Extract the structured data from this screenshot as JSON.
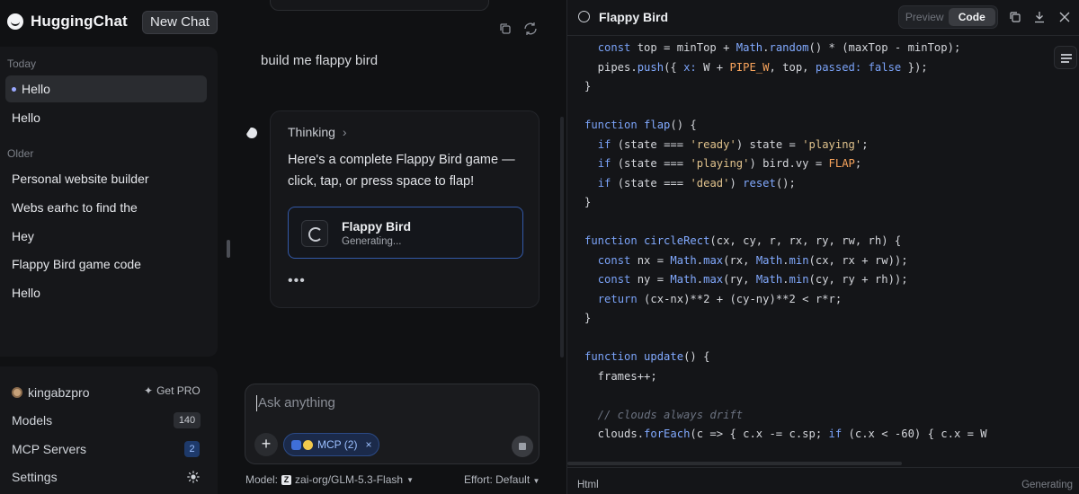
{
  "app": {
    "name": "HuggingChat",
    "new_chat": "New Chat"
  },
  "sidebar": {
    "today_label": "Today",
    "older_label": "Older",
    "today_items": [
      "Hello",
      "Hello"
    ],
    "older_items": [
      "Personal website builder",
      "Webs earhc to find the",
      "Hey",
      "Flappy Bird game code",
      "Hello"
    ],
    "user": "kingabzpro",
    "get_pro": "Get PRO",
    "models_label": "Models",
    "models_count": "140",
    "mcp_label": "MCP Servers",
    "mcp_count": "2",
    "settings_label": "Settings"
  },
  "chat": {
    "user_message": "build me flappy bird",
    "thinking": "Thinking",
    "assistant_text": "Here's a complete Flappy Bird game — click, tap, or press space to flap!",
    "artifact_title": "Flappy Bird",
    "artifact_status": "Generating...",
    "dots": "•••",
    "input_placeholder": "Ask anything",
    "mcp_chip": "MCP (2)",
    "model_label": "Model:",
    "model_name": "zai-org/GLM-5.3-Flash",
    "effort": "Effort: Default"
  },
  "code_panel": {
    "title": "Flappy Bird",
    "tabs": [
      "Preview",
      "Code"
    ],
    "active_tab": "Code",
    "language": "Html",
    "status": "Generating",
    "lines": [
      [
        [
          "",
          "  "
        ],
        [
          "k",
          "const"
        ],
        [
          "",
          " top = minTop + "
        ],
        [
          "f",
          "Math"
        ],
        [
          "",
          "."
        ],
        [
          "f",
          "random"
        ],
        [
          "",
          "() * (maxTop - minTop);"
        ]
      ],
      [
        [
          "",
          "  pipes."
        ],
        [
          "f",
          "push"
        ],
        [
          "",
          "({ "
        ],
        [
          "k",
          "x:"
        ],
        [
          "",
          " W + "
        ],
        [
          "n",
          "PIPE_W"
        ],
        [
          "",
          ", top, "
        ],
        [
          "k",
          "passed:"
        ],
        [
          "",
          " "
        ],
        [
          "k",
          "false"
        ],
        [
          "",
          " });"
        ]
      ],
      [
        [
          "",
          "}"
        ]
      ],
      [
        [
          "",
          ""
        ]
      ],
      [
        [
          "k",
          "function"
        ],
        [
          "",
          " "
        ],
        [
          "f",
          "flap"
        ],
        [
          "",
          "() {"
        ]
      ],
      [
        [
          "",
          "  "
        ],
        [
          "k",
          "if"
        ],
        [
          "",
          " (state === "
        ],
        [
          "s",
          "'ready'"
        ],
        [
          "",
          ") state = "
        ],
        [
          "s",
          "'playing'"
        ],
        [
          "",
          ";"
        ]
      ],
      [
        [
          "",
          "  "
        ],
        [
          "k",
          "if"
        ],
        [
          "",
          " (state === "
        ],
        [
          "s",
          "'playing'"
        ],
        [
          "",
          ") bird.vy = "
        ],
        [
          "n",
          "FLAP"
        ],
        [
          "",
          ";"
        ]
      ],
      [
        [
          "",
          "  "
        ],
        [
          "k",
          "if"
        ],
        [
          "",
          " (state === "
        ],
        [
          "s",
          "'dead'"
        ],
        [
          "",
          ") "
        ],
        [
          "f",
          "reset"
        ],
        [
          "",
          "();"
        ]
      ],
      [
        [
          "",
          "}"
        ]
      ],
      [
        [
          "",
          ""
        ]
      ],
      [
        [
          "k",
          "function"
        ],
        [
          "",
          " "
        ],
        [
          "f",
          "circleRect"
        ],
        [
          "",
          "(cx, cy, r, rx, ry, rw, rh) {"
        ]
      ],
      [
        [
          "",
          "  "
        ],
        [
          "k",
          "const"
        ],
        [
          "",
          " nx = "
        ],
        [
          "f",
          "Math"
        ],
        [
          "",
          "."
        ],
        [
          "f",
          "max"
        ],
        [
          "",
          "(rx, "
        ],
        [
          "f",
          "Math"
        ],
        [
          "",
          "."
        ],
        [
          "f",
          "min"
        ],
        [
          "",
          "(cx, rx + rw));"
        ]
      ],
      [
        [
          "",
          "  "
        ],
        [
          "k",
          "const"
        ],
        [
          "",
          " ny = "
        ],
        [
          "f",
          "Math"
        ],
        [
          "",
          "."
        ],
        [
          "f",
          "max"
        ],
        [
          "",
          "(ry, "
        ],
        [
          "f",
          "Math"
        ],
        [
          "",
          "."
        ],
        [
          "f",
          "min"
        ],
        [
          "",
          "(cy, ry + rh));"
        ]
      ],
      [
        [
          "",
          "  "
        ],
        [
          "k",
          "return"
        ],
        [
          "",
          " (cx-nx)**2 + (cy-ny)**2 < r*r;"
        ]
      ],
      [
        [
          "",
          "}"
        ]
      ],
      [
        [
          "",
          ""
        ]
      ],
      [
        [
          "k",
          "function"
        ],
        [
          "",
          " "
        ],
        [
          "f",
          "update"
        ],
        [
          "",
          "() {"
        ]
      ],
      [
        [
          "",
          "  frames++;"
        ]
      ],
      [
        [
          "",
          ""
        ]
      ],
      [
        [
          "c",
          "  // clouds always drift"
        ]
      ],
      [
        [
          "",
          "  clouds."
        ],
        [
          "f",
          "forEach"
        ],
        [
          "",
          "(c => { c.x -= c.sp; "
        ],
        [
          "k",
          "if"
        ],
        [
          "",
          " (c.x < -60) { c.x = W"
        ]
      ]
    ]
  },
  "colors": {
    "accent": "#3359a8",
    "background": "#101113",
    "panel": "#16171a"
  }
}
